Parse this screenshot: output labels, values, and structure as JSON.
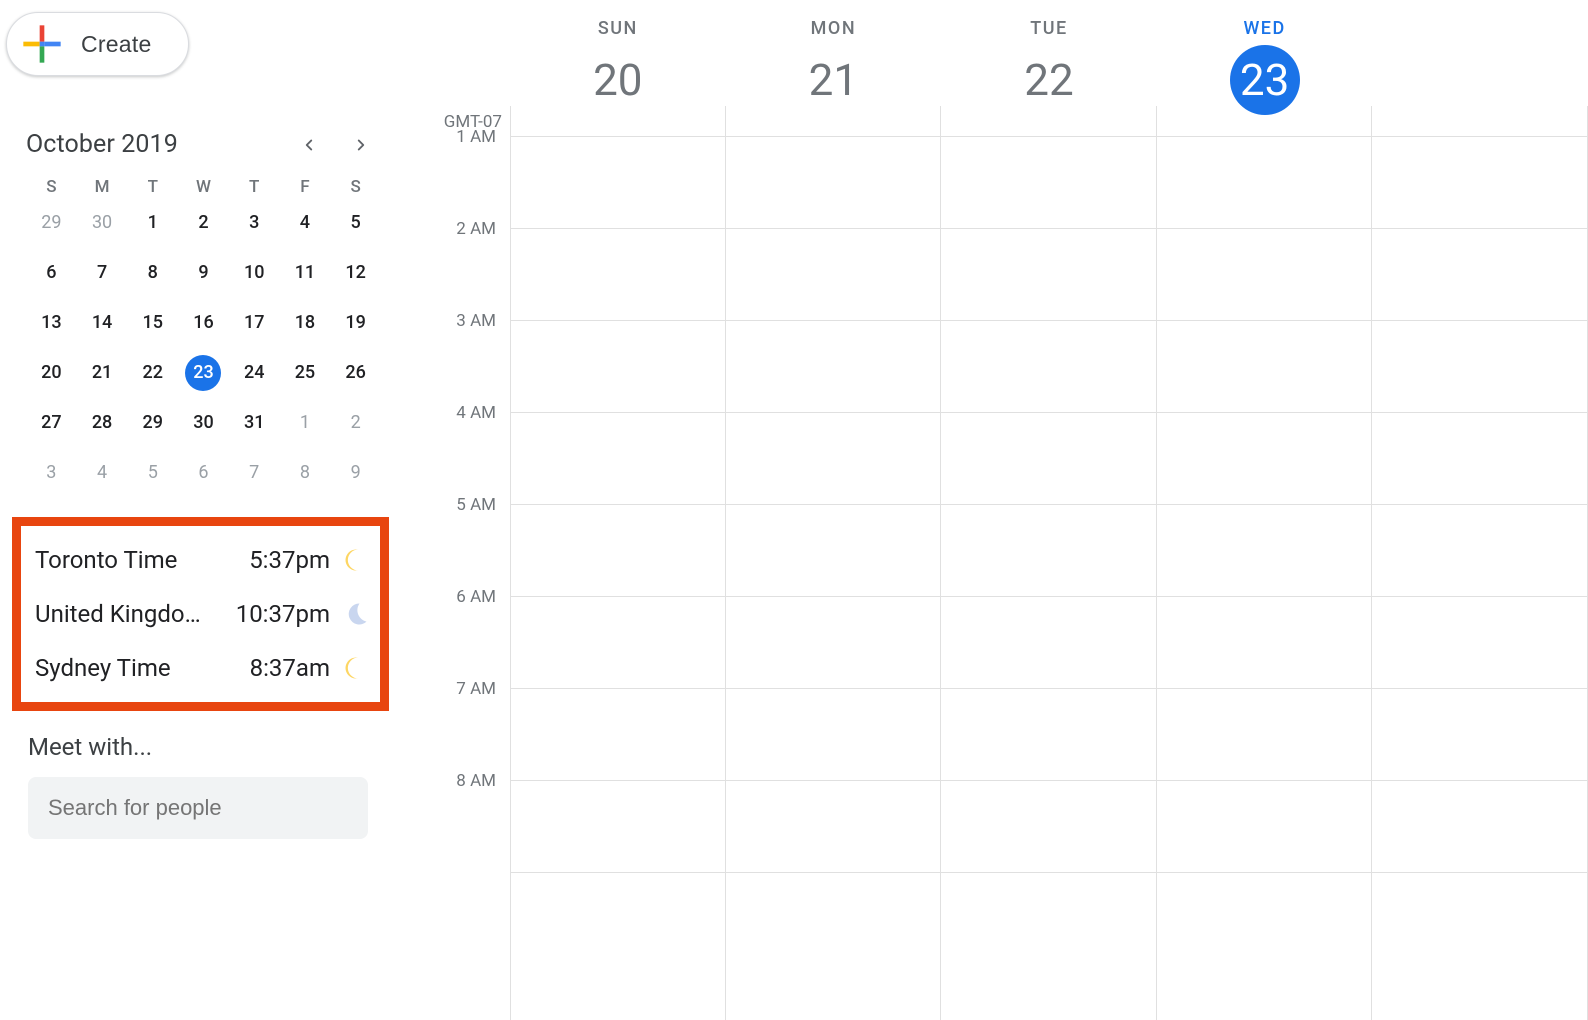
{
  "sidebar": {
    "create_label": "Create",
    "mini_calendar": {
      "title": "October 2019",
      "dow": [
        "S",
        "M",
        "T",
        "W",
        "T",
        "F",
        "S"
      ],
      "weeks": [
        [
          {
            "n": "29",
            "o": true
          },
          {
            "n": "30",
            "o": true
          },
          {
            "n": "1"
          },
          {
            "n": "2"
          },
          {
            "n": "3"
          },
          {
            "n": "4"
          },
          {
            "n": "5"
          }
        ],
        [
          {
            "n": "6"
          },
          {
            "n": "7"
          },
          {
            "n": "8"
          },
          {
            "n": "9"
          },
          {
            "n": "10"
          },
          {
            "n": "11"
          },
          {
            "n": "12"
          }
        ],
        [
          {
            "n": "13"
          },
          {
            "n": "14"
          },
          {
            "n": "15"
          },
          {
            "n": "16"
          },
          {
            "n": "17"
          },
          {
            "n": "18"
          },
          {
            "n": "19"
          }
        ],
        [
          {
            "n": "20"
          },
          {
            "n": "21"
          },
          {
            "n": "22"
          },
          {
            "n": "23",
            "today": true
          },
          {
            "n": "24"
          },
          {
            "n": "25"
          },
          {
            "n": "26"
          }
        ],
        [
          {
            "n": "27"
          },
          {
            "n": "28"
          },
          {
            "n": "29"
          },
          {
            "n": "30"
          },
          {
            "n": "31"
          },
          {
            "n": "1",
            "o": true
          },
          {
            "n": "2",
            "o": true
          }
        ],
        [
          {
            "n": "3",
            "o": true
          },
          {
            "n": "4",
            "o": true
          },
          {
            "n": "5",
            "o": true
          },
          {
            "n": "6",
            "o": true
          },
          {
            "n": "7",
            "o": true
          },
          {
            "n": "8",
            "o": true
          },
          {
            "n": "9",
            "o": true
          }
        ]
      ]
    },
    "world_clock": [
      {
        "name": "Toronto Time",
        "time": "5:37pm",
        "icon": "sun"
      },
      {
        "name": "United Kingdo…",
        "time": "10:37pm",
        "icon": "moon"
      },
      {
        "name": "Sydney Time",
        "time": "8:37am",
        "icon": "sun"
      }
    ],
    "meet_with": {
      "title": "Meet with...",
      "placeholder": "Search for people"
    }
  },
  "main": {
    "tz": "GMT-07",
    "days": [
      {
        "dow": "SUN",
        "date": "20"
      },
      {
        "dow": "MON",
        "date": "21"
      },
      {
        "dow": "TUE",
        "date": "22"
      },
      {
        "dow": "WED",
        "date": "23",
        "today": true
      }
    ],
    "hours": [
      "",
      "1 AM",
      "2 AM",
      "3 AM",
      "4 AM",
      "5 AM",
      "6 AM",
      "7 AM",
      "8 AM",
      ""
    ]
  }
}
